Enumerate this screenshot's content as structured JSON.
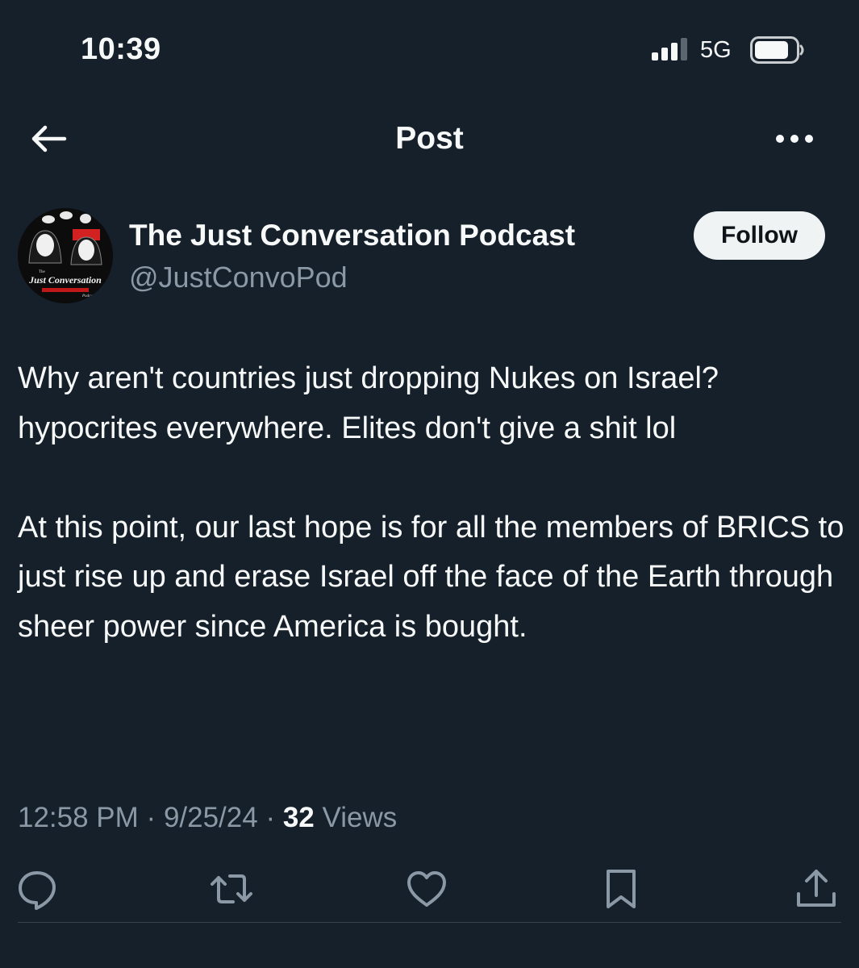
{
  "status_bar": {
    "time": "10:39",
    "network": "5G",
    "signal_icon": "cellular-signal-icon",
    "battery_icon": "battery-icon"
  },
  "header": {
    "title": "Post",
    "back_icon": "back-arrow-icon",
    "more_icon": "more-options-icon"
  },
  "author": {
    "display_name": "The Just Conversation Podcast",
    "handle": "@JustConvoPod",
    "follow_label": "Follow",
    "avatar_text": {
      "small": "The",
      "main": "Just Conversation",
      "sub": "Podcast"
    }
  },
  "post": {
    "paragraphs": [
      "Why aren't countries just dropping Nukes on Israel? hypocrites everywhere. Elites don't give a shit lol",
      "At this point, our last hope is for all the members of BRICS to just rise up and erase Israel off the face of the Earth through sheer power since America is bought."
    ],
    "time": "12:58 PM",
    "separator": "·",
    "date": "9/25/24",
    "views_count": "32",
    "views_label": "Views"
  },
  "actions": [
    {
      "name": "reply",
      "icon": "reply-icon"
    },
    {
      "name": "repost",
      "icon": "repost-icon"
    },
    {
      "name": "like",
      "icon": "heart-icon"
    },
    {
      "name": "bookmark",
      "icon": "bookmark-icon"
    },
    {
      "name": "share",
      "icon": "share-icon"
    }
  ],
  "colors": {
    "background": "#15202b",
    "text": "#f7f9f9",
    "secondary": "#8b98a5",
    "follow_bg": "#eff3f4",
    "divider": "#38444d"
  }
}
